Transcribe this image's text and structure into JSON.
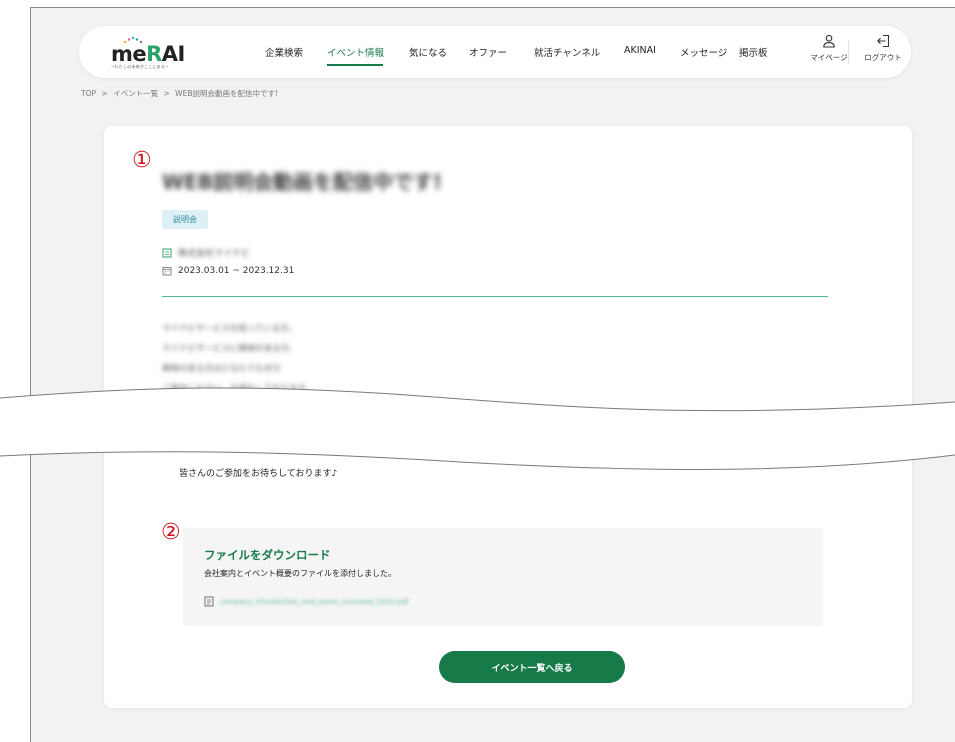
{
  "brand": {
    "logo": "meRAI",
    "tagline": "~わたしの未来がここにある~",
    "accent": "#167a49"
  },
  "nav": {
    "items": [
      {
        "label": "企業検索"
      },
      {
        "label": "イベント情報",
        "active": true
      },
      {
        "label": "気になる"
      },
      {
        "label": "オファー"
      },
      {
        "label": "就活チャンネル"
      },
      {
        "label": "AKINAI"
      },
      {
        "label": "メッセージ"
      },
      {
        "label": "掲示板"
      }
    ],
    "mypage": {
      "label": "マイページ",
      "icon": "user-icon"
    },
    "logout": {
      "label": "ログアウト",
      "icon": "logout-icon"
    }
  },
  "breadcrumb": [
    "TOP",
    ">",
    "イベント一覧",
    ">",
    "WEB説明会動画を配信中です!"
  ],
  "event": {
    "marker1": "①",
    "title": "WEB説明会動画を配信中です!",
    "tag": "説明会",
    "company": "株式会社マイナビ",
    "period": "2023.03.01 ~ 2023.12.31",
    "body_lines": [
      "マイナビサービスを知っている方、",
      "マイナビサービスに興味がある方、",
      "興味のある方はどなたでもぜひ",
      "ご参加ください。お待ちしております。"
    ],
    "closing": "皆さんのご参加をお待ちしております♪"
  },
  "download": {
    "marker2": "②",
    "title": "ファイルをダウンロード",
    "description": "会社案内とイベント概要のファイルを添付しました。",
    "filename": "company_introduction_and_event_overview_2023.pdf"
  },
  "back_button": "イベント一覧へ戻る"
}
